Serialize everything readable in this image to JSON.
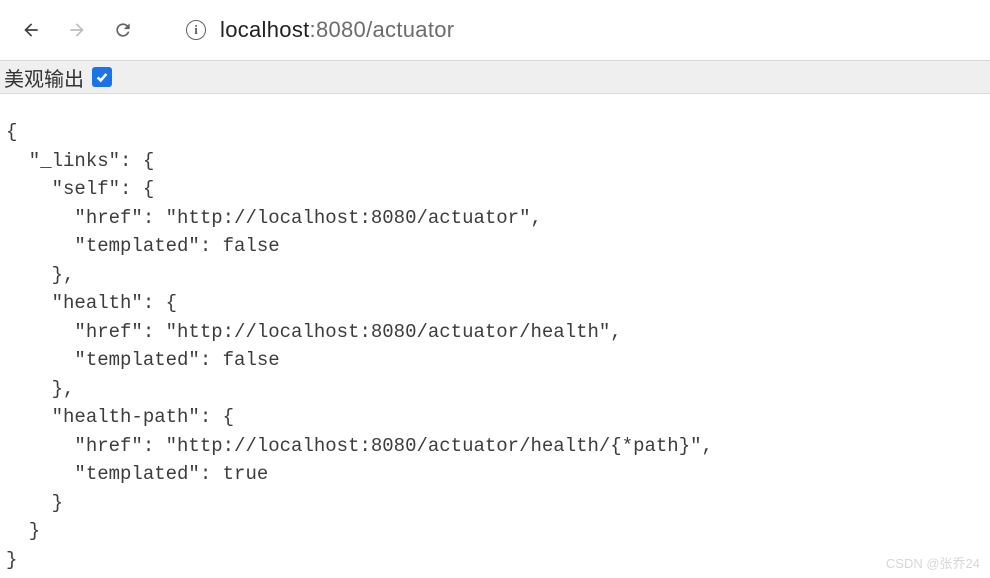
{
  "toolbar": {
    "url_host": "localhost",
    "url_rest": ":8080/actuator"
  },
  "pretty_bar": {
    "label": "美观输出",
    "checked": true
  },
  "json": {
    "line1": "{",
    "line2": "  \"_links\": {",
    "line3": "    \"self\": {",
    "line4": "      \"href\": \"http://localhost:8080/actuator\",",
    "line5": "      \"templated\": false",
    "line6": "    },",
    "line7": "    \"health\": {",
    "line8": "      \"href\": \"http://localhost:8080/actuator/health\",",
    "line9": "      \"templated\": false",
    "line10": "    },",
    "line11": "    \"health-path\": {",
    "line12": "      \"href\": \"http://localhost:8080/actuator/health/{*path}\",",
    "line13": "      \"templated\": true",
    "line14": "    }",
    "line15": "  }",
    "line16": "}"
  },
  "watermark": "CSDN @张乔24"
}
